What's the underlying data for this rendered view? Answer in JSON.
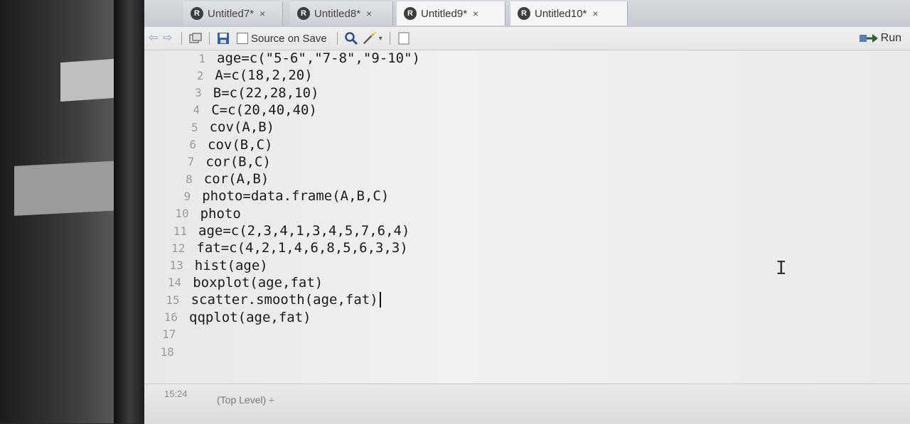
{
  "tabs": [
    {
      "label": "Untitled7*",
      "close": "×"
    },
    {
      "label": "Untitled8*",
      "close": "×"
    },
    {
      "label": "Untitled9*",
      "close": "×"
    },
    {
      "label": "Untitled10*",
      "close": "×"
    }
  ],
  "toolbar": {
    "source_on_save": "Source on Save",
    "run": "Run"
  },
  "editor": {
    "lines": [
      {
        "n": "1",
        "code": "age=c(\"5-6\",\"7-8\",\"9-10\")"
      },
      {
        "n": "2",
        "code": "A=c(18,2,20)"
      },
      {
        "n": "3",
        "code": "B=c(22,28,10)"
      },
      {
        "n": "4",
        "code": "C=c(20,40,40)"
      },
      {
        "n": "5",
        "code": "cov(A,B)"
      },
      {
        "n": "6",
        "code": "cov(B,C)"
      },
      {
        "n": "7",
        "code": "cor(B,C)"
      },
      {
        "n": "8",
        "code": "cor(A,B)"
      },
      {
        "n": "9",
        "code": "photo=data.frame(A,B,C)"
      },
      {
        "n": "10",
        "code": "photo"
      },
      {
        "n": "11",
        "code": "age=c(2,3,4,1,3,4,5,7,6,4)"
      },
      {
        "n": "12",
        "code": "fat=c(4,2,1,4,6,8,5,6,3,3)"
      },
      {
        "n": "13",
        "code": "hist(age)"
      },
      {
        "n": "14",
        "code": "boxplot(age,fat)"
      },
      {
        "n": "15",
        "code": "scatter.smooth(age,fat)"
      },
      {
        "n": "16",
        "code": "qqplot(age,fat)"
      },
      {
        "n": "17",
        "code": ""
      },
      {
        "n": "18",
        "code": ""
      }
    ]
  },
  "status": {
    "position": "15:24",
    "scope": "(Top Level) ÷"
  },
  "colors": {
    "number": "#2431a8",
    "string": "#2b7a2b",
    "line_number": "#9a9a9a"
  }
}
